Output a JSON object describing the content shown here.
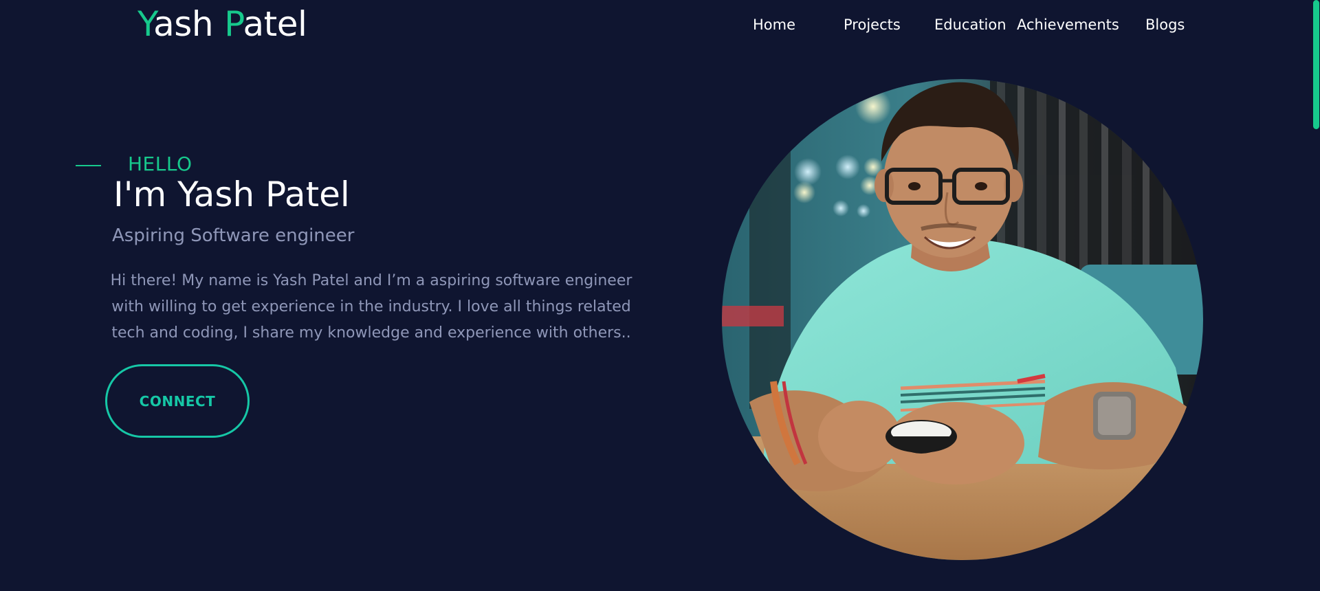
{
  "logo": {
    "first_initial": "Y",
    "first_rest": "ash",
    "last_initial": "P",
    "last_rest": "atel"
  },
  "nav": {
    "items": [
      {
        "label": "Home"
      },
      {
        "label": "Projects"
      },
      {
        "label": "Education"
      },
      {
        "label": "Achievements"
      },
      {
        "label": "Blogs"
      }
    ]
  },
  "hero": {
    "greeting": "HELLO",
    "headline": "I'm Yash Patel",
    "subtitle": "Aspiring Software engineer",
    "bio_lines": [
      "Hi there! My name is Yash Patel and I’m a aspiring software engineer",
      "with willing to get experience in the industry. I love all things related",
      "tech and coding, I share my knowledge and experience with others.."
    ],
    "connect_label": "CONNECT"
  },
  "colors": {
    "background": "#0f1530",
    "accent": "#17c98c",
    "button_accent": "#16c7a6",
    "muted_text": "#8f97b8"
  },
  "icons": {
    "portrait": "profile-photo"
  }
}
